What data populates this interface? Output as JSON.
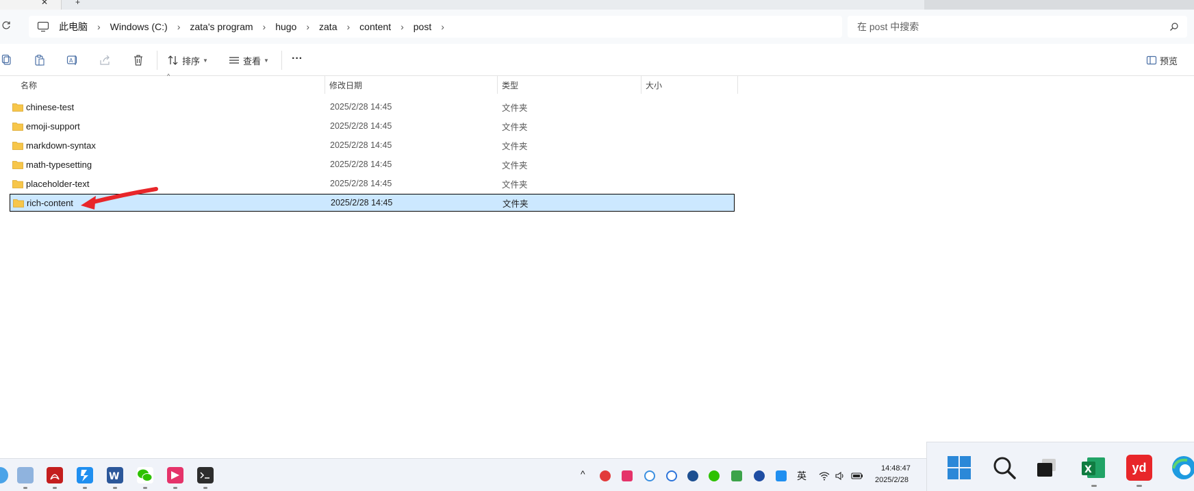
{
  "window": {
    "tab_close": "✕",
    "new_tab": "+"
  },
  "address": {
    "breadcrumbs": [
      "此电脑",
      "Windows  (C:)",
      "zata's program",
      "hugo",
      "zata",
      "content",
      "post"
    ],
    "search_placeholder": "在 post 中搜索"
  },
  "toolbar": {
    "sort_label": "排序",
    "view_label": "查看",
    "more_label": "···",
    "preview_label": "预览"
  },
  "columns": {
    "name": "名称",
    "modified": "修改日期",
    "type": "类型",
    "size": "大小"
  },
  "files": [
    {
      "name": "chinese-test",
      "modified": "2025/2/28 14:45",
      "type": "文件夹",
      "selected": false
    },
    {
      "name": "emoji-support",
      "modified": "2025/2/28 14:45",
      "type": "文件夹",
      "selected": false
    },
    {
      "name": "markdown-syntax",
      "modified": "2025/2/28 14:45",
      "type": "文件夹",
      "selected": false
    },
    {
      "name": "math-typesetting",
      "modified": "2025/2/28 14:45",
      "type": "文件夹",
      "selected": false
    },
    {
      "name": "placeholder-text",
      "modified": "2025/2/28 14:45",
      "type": "文件夹",
      "selected": false
    },
    {
      "name": "rich-content",
      "modified": "2025/2/28 14:45",
      "type": "文件夹",
      "selected": true
    }
  ],
  "taskbar": {
    "ime_label": "英",
    "clock_time": "14:48:47",
    "clock_date": "2025/2/28",
    "big_app_label": "yd"
  },
  "colors": {
    "selection_bg": "#cce8ff",
    "folder": "#f7c64a",
    "annotation_arrow": "#e8262a"
  }
}
